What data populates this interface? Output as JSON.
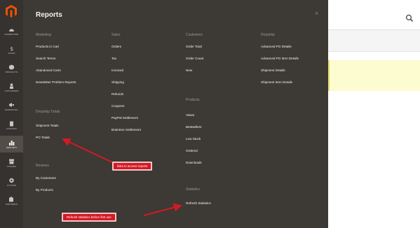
{
  "sidebar": {
    "items": [
      {
        "label": "DASHBOARD",
        "icon": "dashboard-icon"
      },
      {
        "label": "SALES",
        "icon": "dollar-icon"
      },
      {
        "label": "PRODUCTS",
        "icon": "cube-icon"
      },
      {
        "label": "CUSTOMERS",
        "icon": "person-icon"
      },
      {
        "label": "MARKETING",
        "icon": "megaphone-icon"
      },
      {
        "label": "CONTENT",
        "icon": "content-icon"
      },
      {
        "label": "REPORTS",
        "icon": "bar-chart-icon"
      },
      {
        "label": "STORES",
        "icon": "store-icon"
      },
      {
        "label": "SYSTEM",
        "icon": "gear-icon"
      },
      {
        "label": "PARTNERS",
        "icon": "puzzle-icon"
      }
    ]
  },
  "panel": {
    "title": "Reports",
    "close": "×"
  },
  "columns": {
    "marketing": {
      "heading": "Marketing",
      "items": [
        "Products in Cart",
        "Search Terms",
        "Abandoned Carts",
        "Newsletter Problem Reports"
      ]
    },
    "dropship": {
      "heading": "Dropship Totals",
      "items": [
        "Shipment Totals",
        "PO Totals"
      ]
    },
    "reviews": {
      "heading": "Reviews",
      "items": [
        "By Customers",
        "By Products"
      ]
    },
    "sales": {
      "heading": "Sales",
      "items": [
        "Orders",
        "Tax",
        "Invoiced",
        "Shipping",
        "Refunds",
        "Coupons",
        "PayPal Settlement",
        "Braintree Settlement"
      ]
    },
    "customers": {
      "heading": "Customers",
      "items": [
        "Order Total",
        "Order Count",
        "New"
      ]
    },
    "products": {
      "heading": "Products",
      "items": [
        "Views",
        "Bestsellers",
        "Low Stock",
        "Ordered",
        "Downloads"
      ]
    },
    "statistics": {
      "heading": "Statistics",
      "items": [
        "Refresh Statistics"
      ]
    },
    "dropship_details": {
      "heading": "Dropship",
      "items": [
        "Advanced PO Details",
        "Advanced PO Item Details",
        "Shipment Details",
        "Shipment Item Details"
      ]
    }
  },
  "annotations": {
    "po_reports": "links to access reports",
    "refresh": "Refresh statistics before first use"
  },
  "colors": {
    "sidebar": "#36322f",
    "panel": "#3d3935",
    "annotation": "#d21a25",
    "highlight": "#fdfbd0"
  }
}
